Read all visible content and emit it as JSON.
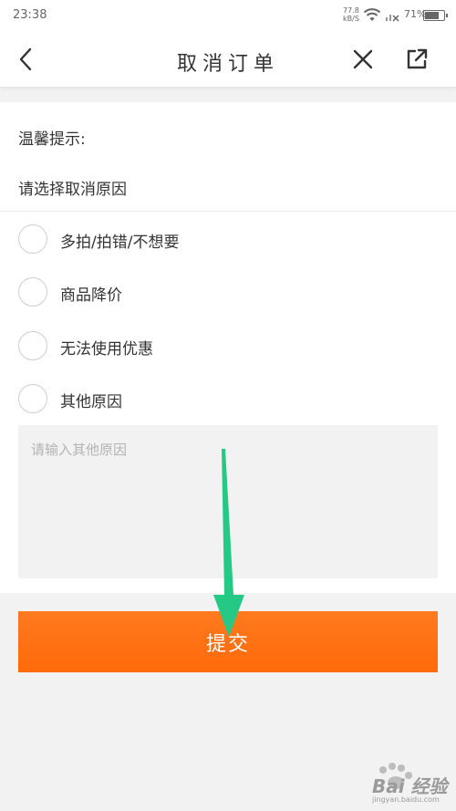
{
  "status": {
    "time": "23:38",
    "speed_value": "77.8",
    "speed_unit": "kB/S",
    "battery": "71%"
  },
  "nav": {
    "title": "取消订单",
    "back_icon": "chevron-left-icon",
    "close_icon": "close-icon",
    "share_icon": "share-icon"
  },
  "form": {
    "tip_label": "温馨提示:",
    "select_label": "请选择取消原因",
    "options": [
      {
        "label": "多拍/拍错/不想要",
        "selected": false
      },
      {
        "label": "商品降价",
        "selected": false
      },
      {
        "label": "无法使用优惠",
        "selected": false
      },
      {
        "label": "其他原因",
        "selected": false
      }
    ],
    "other_reason_placeholder": "请输入其他原因",
    "other_reason_value": "",
    "submit_label": "提交"
  },
  "watermark": {
    "text": "Bai 经验",
    "sub": "jingyan.baidu.com"
  },
  "colors": {
    "accent": "#ff6c0e",
    "arrow": "#25c884"
  }
}
